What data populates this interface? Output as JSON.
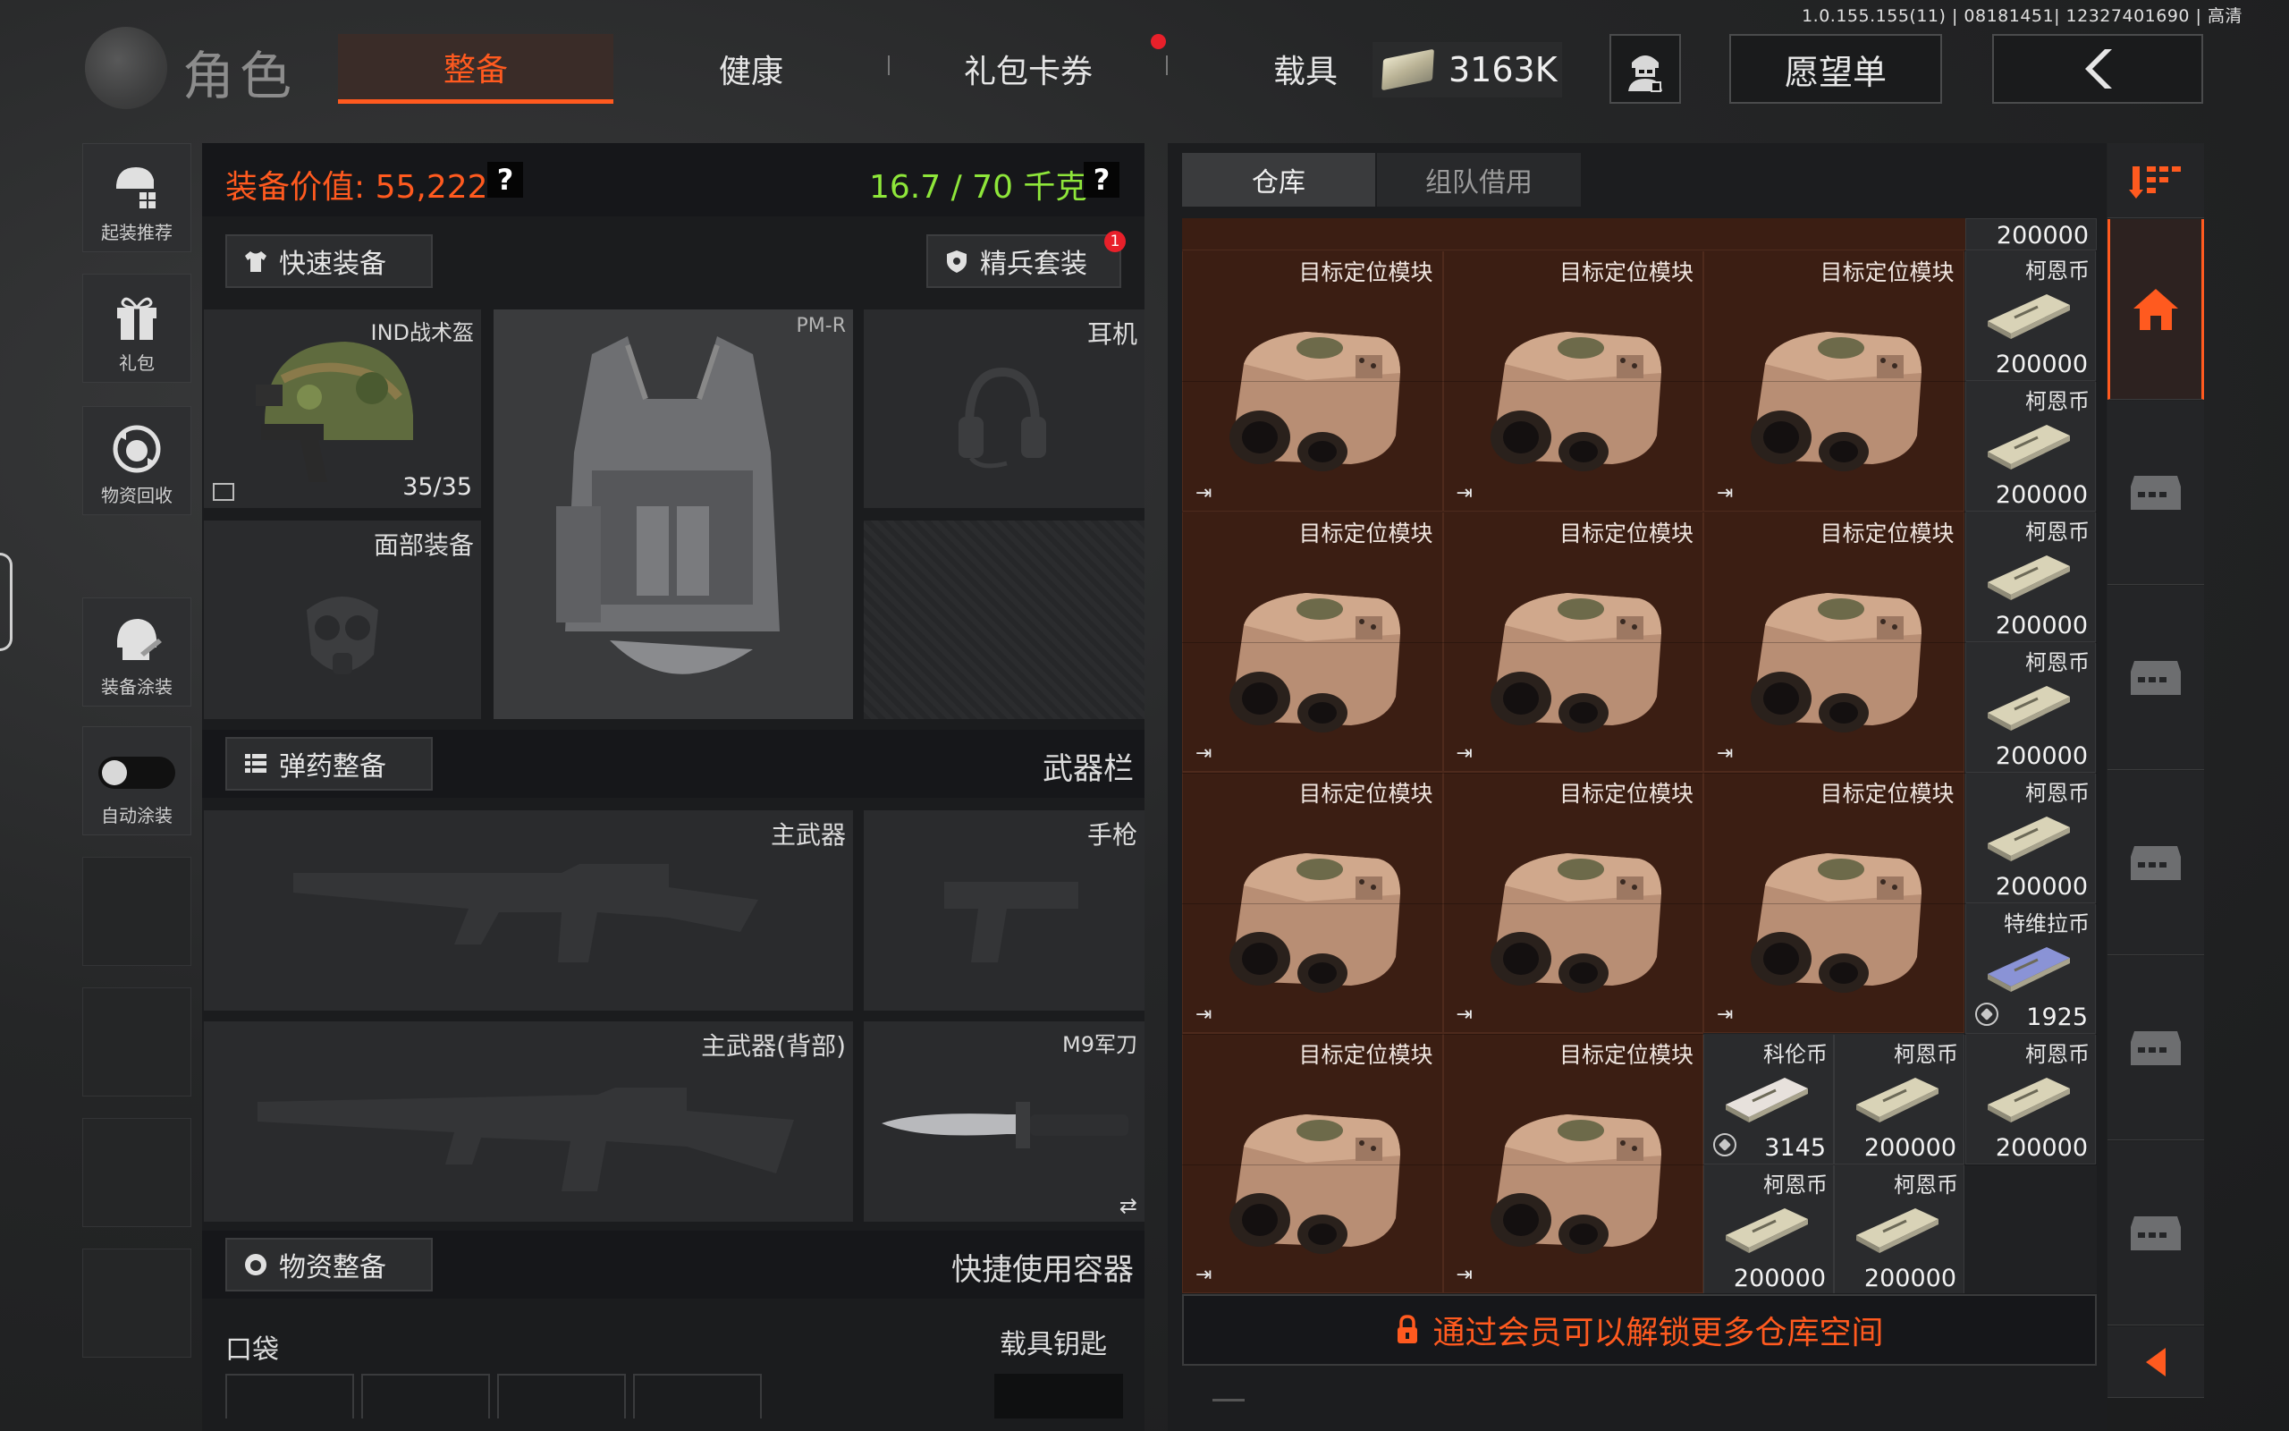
{
  "version": "1.0.155.155(11) | 08181451| 12327401690 | 高清",
  "header": {
    "title": "角色",
    "tabs": [
      {
        "label": "整备",
        "active": true
      },
      {
        "label": "健康",
        "active": false
      },
      {
        "label": "礼包卡券",
        "active": false,
        "badge": true
      },
      {
        "label": "载具",
        "active": false
      }
    ],
    "money": "3163K",
    "wishlist": "愿望单"
  },
  "sidebar": {
    "items": [
      {
        "label": "起装推荐",
        "icon": "loadout-recommend-icon"
      },
      {
        "label": "礼包",
        "icon": "gift-icon"
      },
      {
        "label": "物资回收",
        "icon": "recycle-icon"
      },
      {
        "label": "装备涂装",
        "icon": "skin-paint-icon"
      },
      {
        "label": "自动涂装",
        "icon": "toggle-icon"
      }
    ]
  },
  "equipment": {
    "value_label": "装备价值: 55,222",
    "weight_label": "16.7 / 70 千克",
    "quick_equip": "快速装备",
    "elite_set": "精兵套装",
    "elite_badge": "1",
    "helmet_name": "IND战术盔",
    "helmet_durability": "35/35",
    "vest_name": "PM-R",
    "headset_label": "耳机",
    "face_label": "面部装备",
    "ammo_btn": "弹药整备",
    "weapons_title": "武器栏",
    "primary_label": "主武器",
    "pistol_label": "手枪",
    "primary_back_label": "主武器(背部)",
    "knife_label": "M9军刀",
    "supplies_btn": "物资整备",
    "quick_container": "快捷使用容器",
    "pocket_label": "口袋",
    "vehicle_key_label": "载具钥匙"
  },
  "warehouse": {
    "tabs": [
      {
        "label": "仓库",
        "active": true
      },
      {
        "label": "组队借用",
        "active": false
      }
    ],
    "module_name": "目标定位模块",
    "modules": [
      {
        "row": 0,
        "col": 0
      },
      {
        "row": 0,
        "col": 1
      },
      {
        "row": 0,
        "col": 2
      },
      {
        "row": 1,
        "col": 0
      },
      {
        "row": 1,
        "col": 1
      },
      {
        "row": 1,
        "col": 2
      },
      {
        "row": 2,
        "col": 0
      },
      {
        "row": 2,
        "col": 1
      },
      {
        "row": 2,
        "col": 2
      },
      {
        "row": 3,
        "col": 0
      },
      {
        "row": 3,
        "col": 1
      }
    ],
    "top_partial_qty": "200000",
    "currencies": [
      {
        "name": "柯恩币",
        "qty": "200000",
        "type": "kean"
      },
      {
        "name": "柯恩币",
        "qty": "200000",
        "type": "kean"
      },
      {
        "name": "柯恩币",
        "qty": "200000",
        "type": "kean"
      },
      {
        "name": "柯恩币",
        "qty": "200000",
        "type": "kean"
      },
      {
        "name": "柯恩币",
        "qty": "200000",
        "type": "kean"
      },
      {
        "name": "特维拉币",
        "qty": "1925",
        "type": "tevila"
      },
      {
        "name": "科伦币",
        "qty": "3145",
        "type": "kolun"
      },
      {
        "name": "柯恩币",
        "qty": "200000",
        "type": "kean"
      },
      {
        "name": "柯恩币",
        "qty": "200000",
        "type": "kean"
      },
      {
        "name": "柯恩币",
        "qty": "200000",
        "type": "kean"
      },
      {
        "name": "柯恩币",
        "qty": "200000",
        "type": "kean"
      }
    ],
    "unlock_text": "通过会员可以解锁更多仓库空间"
  },
  "colors": {
    "accent": "#ff5a1f",
    "weight_green": "#8ee63a",
    "item_bg": "#3b1e13",
    "kean_note": "#d9d3b7",
    "tevila_note": "#8a93d6",
    "kolun_note": "#e7e1dc"
  }
}
